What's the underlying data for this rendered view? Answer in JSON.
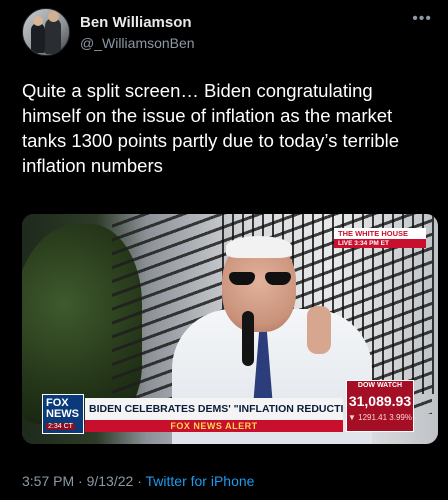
{
  "user": {
    "name": "Ben Williamson",
    "handle": "@_WilliamsonBen",
    "more_glyph": "•••"
  },
  "tweet": {
    "text": "Quite a split screen… Biden congratulating himself on the issue of inflation as the market tanks 1300 points partly due to today’s terrible inflation numbers"
  },
  "media": {
    "bug_line1": "THE WHITE HOUSE",
    "bug_line2": "LIVE  3:34 PM ET",
    "network_line1": "FOX",
    "network_line2": "NEWS",
    "network_time": "2:34 CT",
    "chyron": "BIDEN CELEBRATES DEMS' \"INFLATION REDUCTION ACT\"",
    "alert": "FOX NEWS ALERT",
    "market": {
      "label": "DOW WATCH",
      "value": "31,089.93",
      "change": "1291.41 3.99%",
      "change_direction_glyph": "▼"
    }
  },
  "footer": {
    "time": "3:57 PM",
    "separator": "·",
    "date": "9/13/22",
    "source": "Twitter for iPhone"
  },
  "colors": {
    "background": "#000000",
    "text": "#e7e9ea",
    "muted": "#8b98a5",
    "link": "#1d9bf0",
    "fox_red": "#c8102e",
    "fox_blue": "#0a3a7a"
  }
}
